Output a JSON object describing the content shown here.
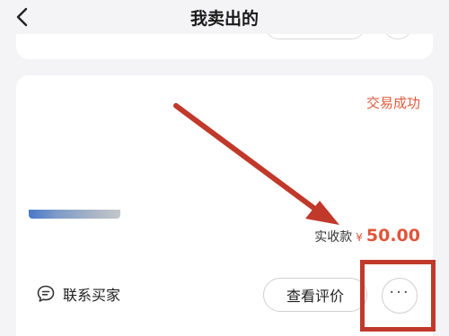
{
  "header": {
    "title": "我卖出的"
  },
  "order": {
    "status": "交易成功",
    "received_label": "实收款",
    "currency_symbol": "¥",
    "received_amount": "50.00",
    "contact_label": "联系买家",
    "review_label": "查看评价",
    "more_label": "···"
  },
  "icons": {
    "back": "chevron-left-icon",
    "contact": "chat-bubble-icon",
    "more": "ellipsis-icon"
  },
  "colors": {
    "accent": "#e0553a",
    "annotation": "#c0392b",
    "background": "#f4f4f6"
  }
}
